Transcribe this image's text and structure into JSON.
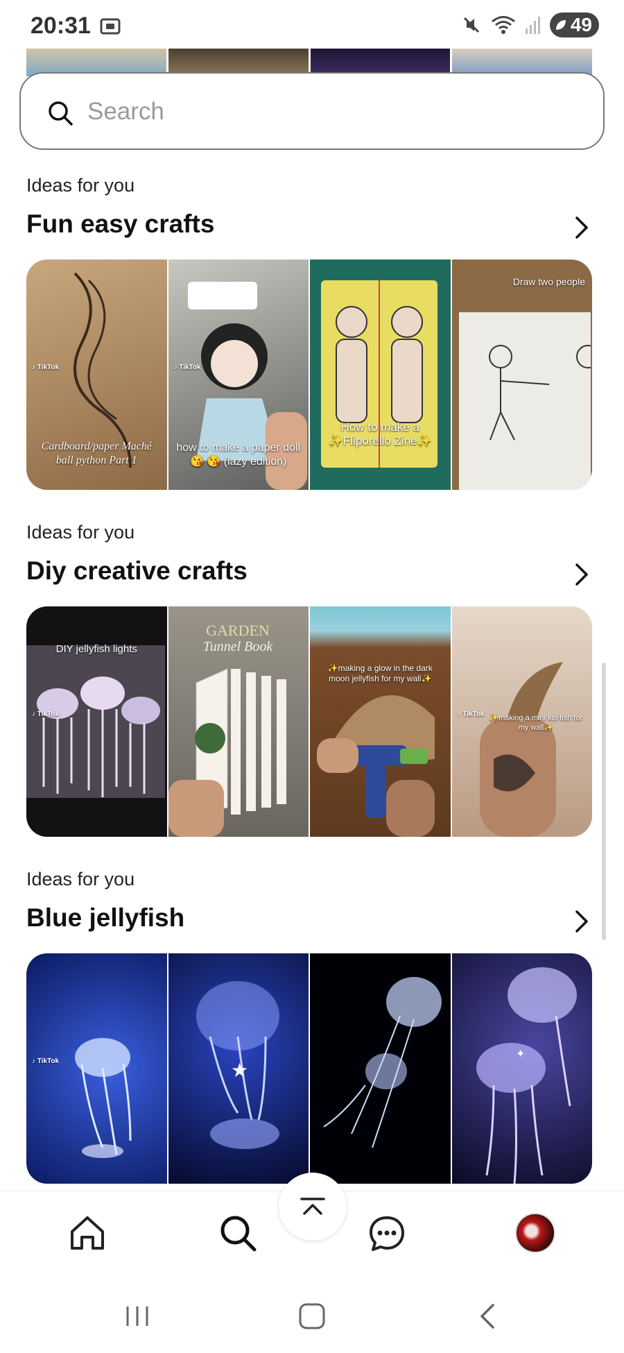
{
  "status_bar": {
    "time": "20:31",
    "battery": "49",
    "icons": [
      "screenshot-icon",
      "mute-icon",
      "wifi-icon",
      "signal-icon",
      "battery-icon"
    ]
  },
  "search": {
    "placeholder": "Search",
    "value": ""
  },
  "sections": [
    {
      "kicker": "Ideas for you",
      "title": "Fun easy crafts",
      "tiles": [
        {
          "caption": "Cardboard/paper Maché ball python Part 1",
          "colors": [
            "#c9a77d",
            "#8d6a45"
          ]
        },
        {
          "caption": "how to make a paper doll 😘 😘 (lazy edition)",
          "colors": [
            "#b9b9b2",
            "#5d5e5c"
          ]
        },
        {
          "caption": "How to make a ✨Fliporello Zine✨",
          "colors": [
            "#e8dc62",
            "#1f6b5d"
          ]
        },
        {
          "caption": "Draw two people",
          "colors": [
            "#e9e8e2",
            "#8b6a45"
          ]
        }
      ]
    },
    {
      "kicker": "Ideas for you",
      "title": "Diy creative crafts",
      "tiles": [
        {
          "caption": "DIY jellyfish lights",
          "colors": [
            "#4b4650",
            "#121214"
          ]
        },
        {
          "caption": "",
          "colors": [
            "#9a958a",
            "#6a665f"
          ]
        },
        {
          "caption": "✨making a glow in the dark moon jellyfish for my wall✨",
          "colors": [
            "#7fc6d6",
            "#7a4c2a"
          ]
        },
        {
          "caption": "✨making a mini koi fish for my wall✨",
          "colors": [
            "#d9cbbd",
            "#b99a82"
          ]
        }
      ]
    },
    {
      "kicker": "Ideas for you",
      "title": "Blue jellyfish",
      "tiles": [
        {
          "caption": "",
          "colors": [
            "#2d4dcc",
            "#0b1a60"
          ]
        },
        {
          "caption": "",
          "colors": [
            "#1a2f8e",
            "#050a2c"
          ]
        },
        {
          "caption": "",
          "colors": [
            "#0a0f2a",
            "#000007"
          ]
        },
        {
          "caption": "",
          "colors": [
            "#3f3c88",
            "#0a0a24"
          ]
        }
      ]
    }
  ],
  "bottom_nav": {
    "items": [
      "home-icon",
      "search-icon",
      "scroll-to-top-icon",
      "messages-icon",
      "profile-avatar"
    ]
  },
  "colors": {
    "text": "#111111",
    "muted": "#9a9a9a",
    "border": "#777777"
  }
}
